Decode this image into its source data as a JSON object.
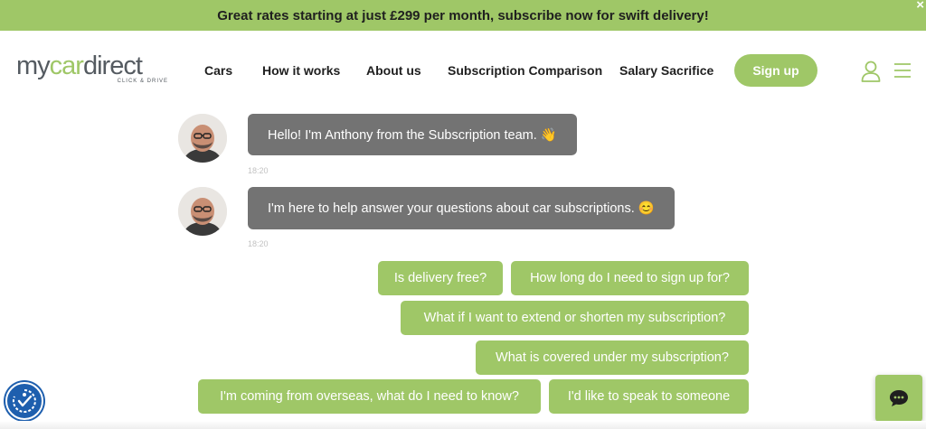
{
  "banner": {
    "text": "Great rates starting at just £299 per month, subscribe now for swift delivery!",
    "close": "×"
  },
  "logo": {
    "prefix": "my",
    "accent": "car",
    "suffix": "direct",
    "tagline": "CLICK & DRIVE"
  },
  "nav": {
    "items": [
      "Cars",
      "How it works",
      "About us",
      "Subscription Comparison",
      "Salary Sacrifice"
    ],
    "signup": "Sign up"
  },
  "chat": {
    "messages": [
      {
        "text": "Hello! I'm Anthony from the Subscription team. 👋",
        "time": "18:20"
      },
      {
        "text": "I'm here to help answer your questions about car subscriptions. 😊",
        "time": "18:20"
      }
    ],
    "quick_replies": [
      "Is delivery free?",
      "How long do I need to sign up for?",
      "What if I want to extend or shorten my subscription?",
      "What is covered under my subscription?",
      "I'm coming from overseas, what do I need to know?",
      "I'd like to speak to someone"
    ]
  },
  "colors": {
    "brand_green": "#9fc767",
    "bubble_grey": "#737373",
    "accessibility_blue": "#1e5fae"
  },
  "icons": [
    "close-icon",
    "user-icon",
    "hamburger-menu-icon",
    "accessibility-icon",
    "chat-bubble-icon"
  ]
}
